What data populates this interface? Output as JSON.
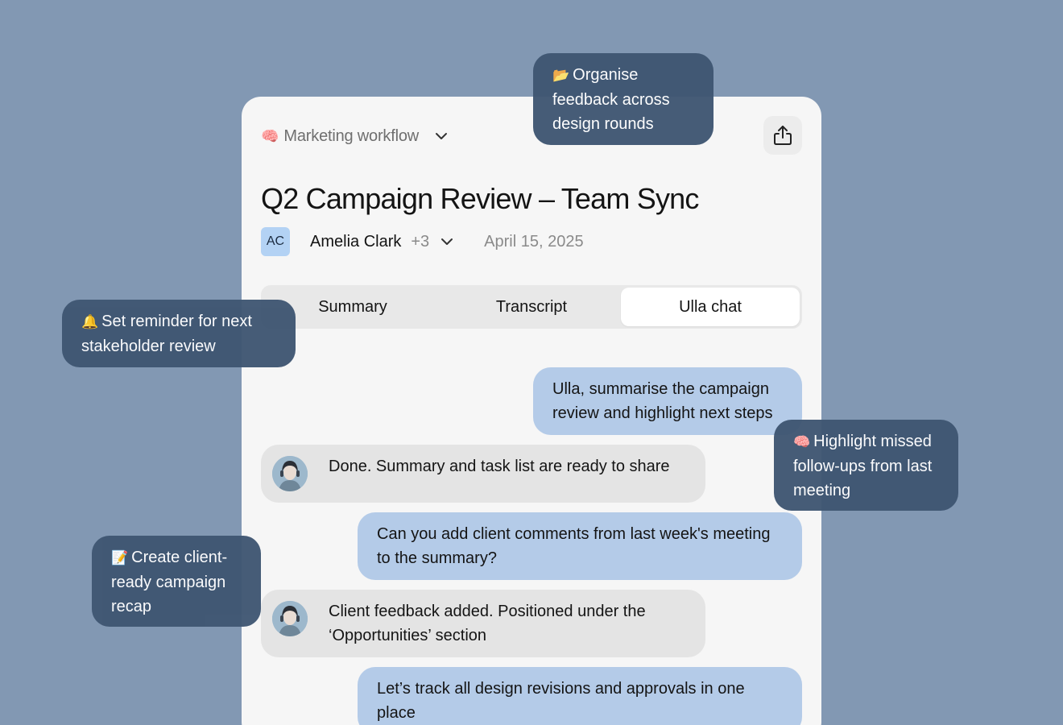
{
  "workspace": {
    "emoji": "🧠",
    "label": "Marketing workflow"
  },
  "meeting": {
    "title": "Q2 Campaign Review – Team Sync",
    "owner_initials": "AC",
    "owner_name": "Amelia Clark",
    "extra_participants": "+3",
    "date": "April 15, 2025"
  },
  "tabs": [
    {
      "label": "Summary"
    },
    {
      "label": "Transcript"
    },
    {
      "label": "Ulla chat"
    }
  ],
  "chat": [
    {
      "role": "user",
      "text": "Ulla, summarise the campaign review and highlight next steps"
    },
    {
      "role": "assistant",
      "text": "Done. Summary and task list are ready to share"
    },
    {
      "role": "user",
      "text": "Can you add client comments from last week's meeting to the summary?"
    },
    {
      "role": "assistant",
      "text": "Client feedback added. Positioned under the ‘Opportunities’ section"
    },
    {
      "role": "user",
      "text": "Let’s track all design revisions and approvals in one place"
    }
  ],
  "callouts": [
    {
      "emoji": "📂",
      "text": "Organise feedback across design rounds"
    },
    {
      "emoji": "🔔",
      "text": "Set reminder for next stakeholder review"
    },
    {
      "emoji": "🧠",
      "text": "Highlight missed follow-ups from last meeting"
    },
    {
      "emoji": "📝",
      "text": "Create client-ready campaign recap"
    }
  ],
  "colors": {
    "background": "#8298b3",
    "card": "#f6f6f6",
    "user_bubble": "#b4cbe8",
    "assistant_bubble": "#e4e4e4",
    "callout": "#3f5672",
    "avatar_ac": "#b3d2f4"
  },
  "icons": {
    "share": "share-icon",
    "chevron": "chevron-down-icon",
    "assistant_avatar": "assistant-avatar"
  }
}
